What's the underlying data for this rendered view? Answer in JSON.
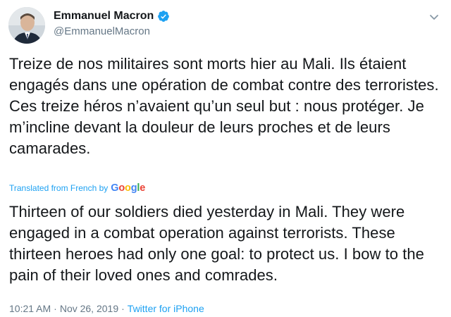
{
  "author": {
    "display_name": "Emmanuel Macron",
    "handle": "@EmmanuelMacron",
    "verified_icon": "verified-badge-icon",
    "avatar_icon": "avatar"
  },
  "tweet": {
    "original_text": "Treize de nos militaires sont morts hier au Mali. Ils étaient engagés dans une opération de combat contre des terroristes. Ces treize héros n’avaient qu’un seul but : nous protéger. Je m’incline devant la douleur de leurs proches et de leurs camarades.",
    "translation_label": "Translated from French by",
    "translation_provider": "Google",
    "translated_text": "Thirteen of our soldiers died yesterday in Mali. They were engaged in a combat operation against terrorists. These thirteen heroes had only one goal: to protect us. I bow to the pain of their loved ones and comrades.",
    "time": "10:21 AM",
    "separator": "·",
    "date": "Nov 26, 2019",
    "source": "Twitter for iPhone"
  },
  "colors": {
    "link": "#1da1f2",
    "text": "#14171a",
    "muted": "#657786"
  }
}
